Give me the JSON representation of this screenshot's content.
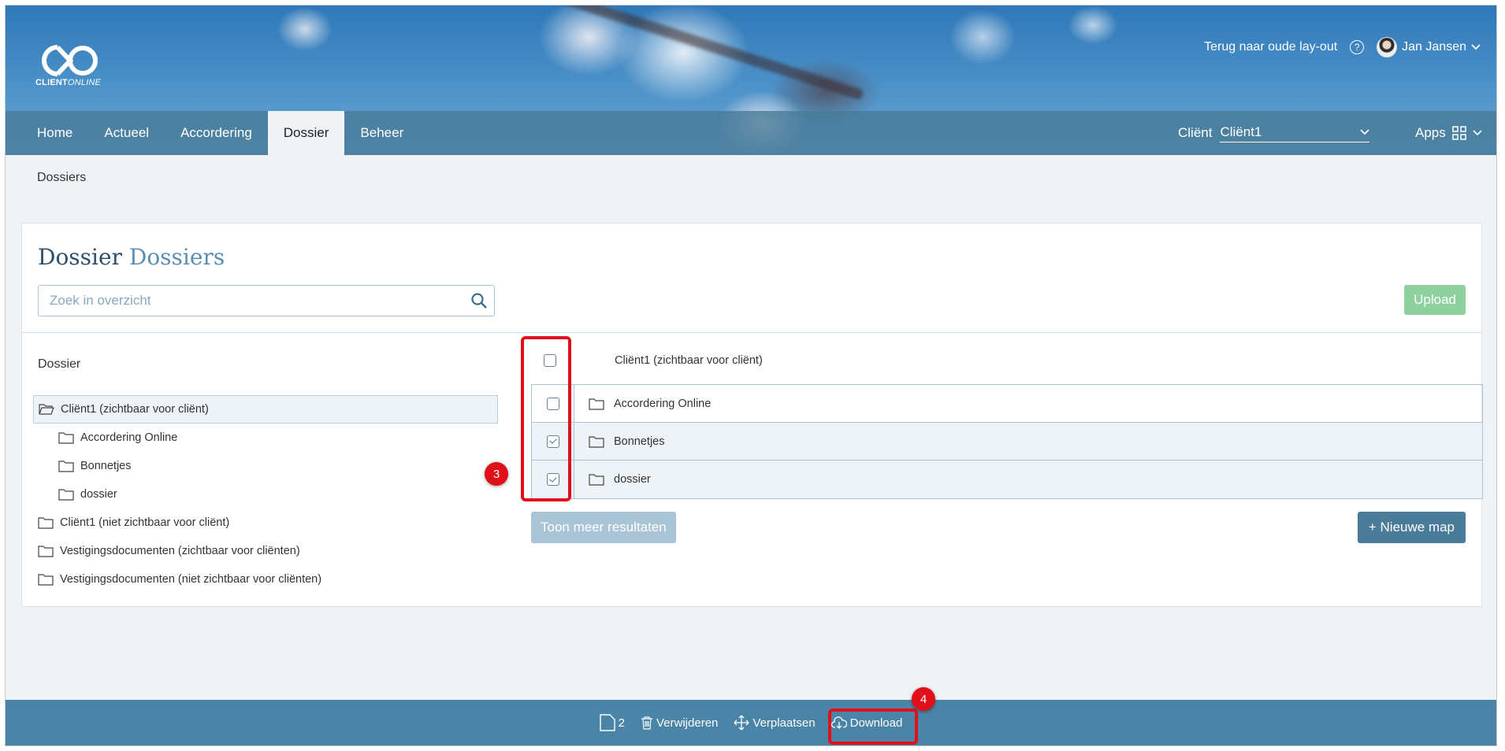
{
  "header": {
    "logo_text_bold": "CLIENT",
    "logo_text_italic": "ONLINE",
    "old_layout_link": "Terug naar oude lay-out",
    "help_glyph": "?",
    "user_name": "Jan Jansen"
  },
  "nav": {
    "items": [
      "Home",
      "Actueel",
      "Accordering",
      "Dossier",
      "Beheer"
    ],
    "active": "Dossier",
    "client_label": "Cliënt",
    "client_value": "Cliënt1",
    "apps_label": "Apps"
  },
  "breadcrumb": "Dossiers",
  "panel": {
    "title_main": "Dossier",
    "title_sub": "Dossiers",
    "search_placeholder": "Zoek in overzicht",
    "upload_label": "Upload"
  },
  "tree": {
    "heading": "Dossier",
    "items": [
      {
        "label": "Cliënt1 (zichtbaar voor cliënt)",
        "selected": true,
        "open": true
      },
      {
        "label": "Accordering Online",
        "child": true
      },
      {
        "label": "Bonnetjes",
        "child": true
      },
      {
        "label": "dossier",
        "child": true
      },
      {
        "label": "Cliënt1 (niet zichtbaar voor cliënt)"
      },
      {
        "label": "Vestigingsdocumenten (zichtbaar voor cliënten)"
      },
      {
        "label": "Vestigingsdocumenten (niet zichtbaar voor cliënten)"
      }
    ]
  },
  "list": {
    "header_label": "Cliënt1 (zichtbaar voor cliënt)",
    "rows": [
      {
        "label": "Accordering Online",
        "checked": false
      },
      {
        "label": "Bonnetjes",
        "checked": true
      },
      {
        "label": "dossier",
        "checked": true
      }
    ],
    "more_label": "Toon meer resultaten",
    "new_folder_label": "+  Nieuwe map"
  },
  "annotations": {
    "badge_3": "3",
    "badge_4": "4",
    "color": "#e0101a"
  },
  "bottombar": {
    "selected_count": "2",
    "delete_label": "Verwijderen",
    "move_label": "Verplaatsen",
    "download_label": "Download"
  }
}
